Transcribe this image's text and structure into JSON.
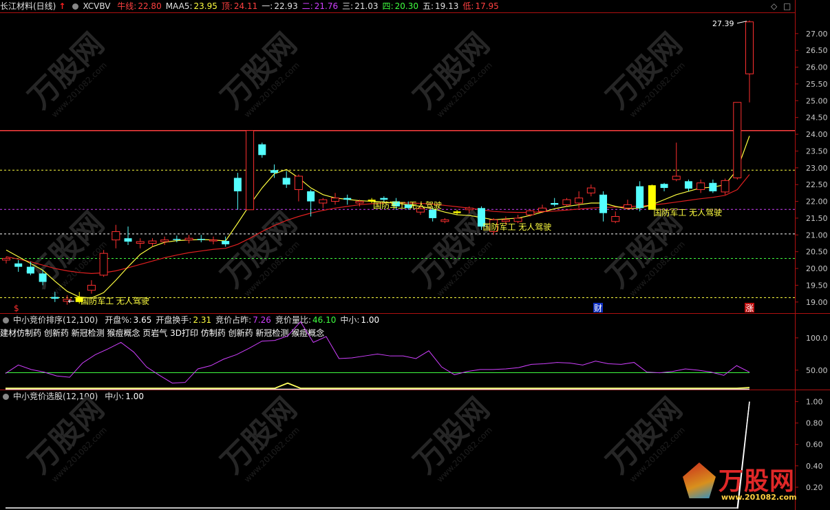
{
  "header": {
    "stock": "长江材料(日线)",
    "indicator": "XCVBV",
    "items": [
      {
        "label": "牛线",
        "value": "22.80",
        "label_color": "#ff4040",
        "value_color": "#ff4040"
      },
      {
        "label": "MAA5",
        "value": "23.95",
        "label_color": "#e0e0e0",
        "value_color": "#ffff40"
      },
      {
        "label": "顶",
        "value": "24.11",
        "label_color": "#ff4040",
        "value_color": "#ff4040"
      },
      {
        "label": "一",
        "value": "22.93",
        "label_color": "#e0e0e0",
        "value_color": "#e0e0e0"
      },
      {
        "label": "二",
        "value": "21.76",
        "label_color": "#d040ff",
        "value_color": "#d040ff"
      },
      {
        "label": "三",
        "value": "21.03",
        "label_color": "#e0e0e0",
        "value_color": "#e0e0e0"
      },
      {
        "label": "四",
        "value": "20.30",
        "label_color": "#40ff40",
        "value_color": "#40ff40"
      },
      {
        "label": "五",
        "value": "19.13",
        "label_color": "#e0e0e0",
        "value_color": "#e0e0e0"
      },
      {
        "label": "低",
        "value": "17.95",
        "label_color": "#ff4040",
        "value_color": "#ff4040"
      }
    ]
  },
  "panel2": {
    "title": "中小竞价排序",
    "params": "(12,100)",
    "items": [
      {
        "label": "开盘%",
        "value": "3.65",
        "color": "#ffffff"
      },
      {
        "label": "开盘换手",
        "value": "2.31",
        "color": "#ffff40"
      },
      {
        "label": "竞价占昨",
        "value": "7.26",
        "color": "#d040ff"
      },
      {
        "label": "竞价量比",
        "value": "46.10",
        "color": "#40ff40"
      },
      {
        "label": "中小",
        "value": "1.00",
        "color": "#ffffff"
      }
    ],
    "concepts": "建材仿制药 创新药 新冠检测 猴痘概念 页岩气 3D打印 仿制药 创新药 新冠检测 猴痘概念"
  },
  "panel3": {
    "title": "中小竞价选股",
    "params": "(12,100)",
    "items": [
      {
        "label": "中小",
        "value": "1.00",
        "color": "#ffffff"
      }
    ]
  },
  "annotations": {
    "tag": "国防军工 无人驾驶",
    "peak_label": "27.39",
    "marker_s": "$",
    "marker_cai": "财",
    "marker_zhang": "涨"
  },
  "watermark": {
    "text": "万股网",
    "url": "www.201082.com"
  },
  "colors": {
    "up": "#ff3030",
    "down": "#54ffff",
    "ma_fast": "#ffff40",
    "ma_slow": "#e02020",
    "purple": "#d040ff",
    "green": "#40ff40",
    "yellow": "#ffff00"
  },
  "chart_data": [
    {
      "type": "candlestick",
      "ylim": [
        18.75,
        27.55
      ],
      "yticks": [
        "19.00",
        "19.50",
        "20.00",
        "20.50",
        "21.00",
        "21.50",
        "22.00",
        "22.50",
        "23.00",
        "23.50",
        "24.00",
        "24.50",
        "25.00",
        "25.50",
        "26.00",
        "26.50",
        "27.00"
      ],
      "hlines": [
        {
          "value": 24.11,
          "color": "#ff4040",
          "style": "solid"
        },
        {
          "value": 22.93,
          "color": "#ffff40",
          "style": "dash"
        },
        {
          "value": 21.76,
          "color": "#d040ff",
          "style": "dash"
        },
        {
          "value": 21.03,
          "color": "#ffffff",
          "style": "dash"
        },
        {
          "value": 20.3,
          "color": "#40ff40",
          "style": "dash"
        },
        {
          "value": 19.13,
          "color": "#ffff40",
          "style": "dash"
        }
      ],
      "candles": [
        {
          "o": 20.25,
          "h": 20.35,
          "l": 20.15,
          "c": 20.3,
          "dir": "up"
        },
        {
          "o": 20.15,
          "h": 20.25,
          "l": 19.9,
          "c": 20.05,
          "dir": "down"
        },
        {
          "o": 20.05,
          "h": 20.2,
          "l": 19.8,
          "c": 19.85,
          "dir": "down"
        },
        {
          "o": 19.85,
          "h": 19.95,
          "l": 19.5,
          "c": 19.6,
          "dir": "down"
        },
        {
          "o": 19.15,
          "h": 19.3,
          "l": 19.0,
          "c": 19.1,
          "dir": "down"
        },
        {
          "o": 19.02,
          "h": 19.2,
          "l": 18.92,
          "c": 19.08,
          "dir": "up"
        },
        {
          "o": 19.0,
          "h": 19.3,
          "l": 18.95,
          "c": 19.15,
          "dir": "yellow"
        },
        {
          "o": 19.35,
          "h": 19.65,
          "l": 19.25,
          "c": 19.5,
          "dir": "up"
        },
        {
          "o": 19.8,
          "h": 20.55,
          "l": 19.75,
          "c": 20.45,
          "dir": "up"
        },
        {
          "o": 20.85,
          "h": 21.3,
          "l": 20.6,
          "c": 21.1,
          "dir": "up"
        },
        {
          "o": 20.9,
          "h": 21.25,
          "l": 20.7,
          "c": 20.8,
          "dir": "down"
        },
        {
          "o": 20.75,
          "h": 20.9,
          "l": 20.6,
          "c": 20.8,
          "dir": "up"
        },
        {
          "o": 20.75,
          "h": 20.9,
          "l": 20.65,
          "c": 20.82,
          "dir": "up"
        },
        {
          "o": 20.8,
          "h": 20.95,
          "l": 20.7,
          "c": 20.85,
          "dir": "up"
        },
        {
          "o": 20.88,
          "h": 20.98,
          "l": 20.78,
          "c": 20.85,
          "dir": "down"
        },
        {
          "o": 20.85,
          "h": 21.0,
          "l": 20.75,
          "c": 20.9,
          "dir": "up"
        },
        {
          "o": 20.88,
          "h": 21.0,
          "l": 20.78,
          "c": 20.86,
          "dir": "down"
        },
        {
          "o": 20.82,
          "h": 20.95,
          "l": 20.72,
          "c": 20.85,
          "dir": "up"
        },
        {
          "o": 20.82,
          "h": 20.95,
          "l": 20.65,
          "c": 20.72,
          "dir": "down"
        },
        {
          "o": 22.7,
          "h": 22.85,
          "l": 21.75,
          "c": 22.3,
          "dir": "down"
        },
        {
          "o": 21.75,
          "h": 24.11,
          "l": 21.75,
          "c": 24.11,
          "dir": "up"
        },
        {
          "o": 23.7,
          "h": 23.75,
          "l": 23.3,
          "c": 23.38,
          "dir": "down"
        },
        {
          "o": 22.93,
          "h": 23.1,
          "l": 22.7,
          "c": 22.85,
          "dir": "down"
        },
        {
          "o": 22.7,
          "h": 22.9,
          "l": 22.4,
          "c": 22.5,
          "dir": "down"
        },
        {
          "o": 22.35,
          "h": 22.8,
          "l": 22.0,
          "c": 22.75,
          "dir": "up"
        },
        {
          "o": 22.3,
          "h": 22.35,
          "l": 21.55,
          "c": 22.0,
          "dir": "down"
        },
        {
          "o": 21.95,
          "h": 22.1,
          "l": 21.8,
          "c": 22.05,
          "dir": "up"
        },
        {
          "o": 22.0,
          "h": 22.25,
          "l": 21.9,
          "c": 22.1,
          "dir": "up"
        },
        {
          "o": 22.1,
          "h": 22.2,
          "l": 21.9,
          "c": 22.05,
          "dir": "down"
        },
        {
          "o": 21.95,
          "h": 22.05,
          "l": 21.85,
          "c": 22.0,
          "dir": "up"
        },
        {
          "o": 22.05,
          "h": 22.1,
          "l": 21.95,
          "c": 22.0,
          "dir": "yellow"
        },
        {
          "o": 22.1,
          "h": 22.15,
          "l": 21.95,
          "c": 22.05,
          "dir": "down"
        },
        {
          "o": 22.0,
          "h": 22.1,
          "l": 21.75,
          "c": 21.85,
          "dir": "down"
        },
        {
          "o": 21.9,
          "h": 22.0,
          "l": 21.75,
          "c": 21.8,
          "dir": "down"
        },
        {
          "o": 21.78,
          "h": 21.9,
          "l": 21.6,
          "c": 21.68,
          "dir": "up"
        },
        {
          "o": 21.75,
          "h": 21.8,
          "l": 21.4,
          "c": 21.5,
          "dir": "down"
        },
        {
          "o": 21.4,
          "h": 21.5,
          "l": 21.35,
          "c": 21.45,
          "dir": "up"
        },
        {
          "o": 21.7,
          "h": 21.75,
          "l": 21.6,
          "c": 21.65,
          "dir": "yellow"
        },
        {
          "o": 21.75,
          "h": 21.85,
          "l": 21.65,
          "c": 21.8,
          "dir": "up"
        },
        {
          "o": 21.8,
          "h": 21.85,
          "l": 21.15,
          "c": 21.25,
          "dir": "down"
        },
        {
          "o": 21.1,
          "h": 21.5,
          "l": 21.0,
          "c": 21.45,
          "dir": "up"
        },
        {
          "o": 21.45,
          "h": 21.55,
          "l": 21.3,
          "c": 21.4,
          "dir": "up"
        },
        {
          "o": 21.4,
          "h": 21.6,
          "l": 21.35,
          "c": 21.5,
          "dir": "up"
        },
        {
          "o": 21.6,
          "h": 21.75,
          "l": 21.55,
          "c": 21.72,
          "dir": "up"
        },
        {
          "o": 21.7,
          "h": 21.9,
          "l": 21.65,
          "c": 21.8,
          "dir": "up"
        },
        {
          "o": 21.9,
          "h": 22.1,
          "l": 21.85,
          "c": 21.95,
          "dir": "down"
        },
        {
          "o": 21.9,
          "h": 22.1,
          "l": 21.85,
          "c": 22.05,
          "dir": "up"
        },
        {
          "o": 21.95,
          "h": 22.3,
          "l": 21.8,
          "c": 22.1,
          "dir": "up"
        },
        {
          "o": 22.25,
          "h": 22.5,
          "l": 22.15,
          "c": 22.4,
          "dir": "up"
        },
        {
          "o": 22.2,
          "h": 22.3,
          "l": 21.4,
          "c": 21.65,
          "dir": "down"
        },
        {
          "o": 21.4,
          "h": 21.7,
          "l": 21.35,
          "c": 21.55,
          "dir": "up"
        },
        {
          "o": 21.8,
          "h": 22.05,
          "l": 21.75,
          "c": 21.9,
          "dir": "up"
        },
        {
          "o": 22.45,
          "h": 22.6,
          "l": 21.7,
          "c": 21.8,
          "dir": "down"
        },
        {
          "o": 21.75,
          "h": 22.5,
          "l": 21.75,
          "c": 22.48,
          "dir": "yellow"
        },
        {
          "o": 22.4,
          "h": 22.55,
          "l": 22.3,
          "c": 22.52,
          "dir": "down"
        },
        {
          "o": 22.65,
          "h": 23.75,
          "l": 22.6,
          "c": 22.75,
          "dir": "up"
        },
        {
          "o": 22.6,
          "h": 22.65,
          "l": 22.3,
          "c": 22.38,
          "dir": "down"
        },
        {
          "o": 22.35,
          "h": 22.65,
          "l": 22.25,
          "c": 22.55,
          "dir": "up"
        },
        {
          "o": 22.55,
          "h": 22.65,
          "l": 22.25,
          "c": 22.3,
          "dir": "down"
        },
        {
          "o": 22.28,
          "h": 22.68,
          "l": 22.2,
          "c": 22.62,
          "dir": "up"
        },
        {
          "o": 22.7,
          "h": 24.95,
          "l": 22.65,
          "c": 24.95,
          "dir": "up"
        },
        {
          "o": 25.8,
          "h": 27.39,
          "l": 24.95,
          "c": 27.35,
          "dir": "up"
        }
      ],
      "ma_fast": [
        20.55,
        20.35,
        20.15,
        19.95,
        19.62,
        19.32,
        19.15,
        19.12,
        19.28,
        19.65,
        20.05,
        20.42,
        20.65,
        20.78,
        20.83,
        20.85,
        20.86,
        20.85,
        20.82,
        21.35,
        21.9,
        22.4,
        22.82,
        22.95,
        22.7,
        22.4,
        22.2,
        22.1,
        22.06,
        22.02,
        22.0,
        21.98,
        21.95,
        21.9,
        21.85,
        21.78,
        21.68,
        21.6,
        21.58,
        21.52,
        21.45,
        21.48,
        21.5,
        21.58,
        21.68,
        21.78,
        21.85,
        21.9,
        21.95,
        21.95,
        21.85,
        21.78,
        21.8,
        21.9,
        22.05,
        22.2,
        22.3,
        22.4,
        22.42,
        22.5,
        22.95,
        23.95
      ],
      "ma_slow": [
        20.35,
        20.28,
        20.2,
        20.1,
        20.0,
        19.93,
        19.88,
        19.85,
        19.87,
        19.93,
        20.02,
        20.12,
        20.22,
        20.32,
        20.4,
        20.47,
        20.52,
        20.57,
        20.6,
        20.72,
        20.9,
        21.1,
        21.28,
        21.43,
        21.55,
        21.65,
        21.73,
        21.8,
        21.85,
        21.9,
        21.93,
        21.95,
        21.96,
        21.95,
        21.94,
        21.92,
        21.88,
        21.84,
        21.8,
        21.75,
        21.7,
        21.68,
        21.67,
        21.67,
        21.69,
        21.71,
        21.74,
        21.77,
        21.8,
        21.82,
        21.83,
        21.84,
        21.86,
        21.89,
        21.93,
        21.98,
        22.03,
        22.08,
        22.12,
        22.18,
        22.35,
        22.8
      ]
    },
    {
      "type": "line",
      "ylim": [
        20,
        118
      ],
      "yticks": [
        "50.00",
        "100.0"
      ],
      "hline": 46.1,
      "series": [
        {
          "name": "竞价占昨",
          "color": "#d040ff",
          "values": [
            45,
            58,
            51,
            47,
            41,
            39,
            61,
            74,
            83,
            93,
            78,
            55,
            42,
            30,
            31,
            52,
            57,
            67,
            74,
            84,
            95,
            96,
            103,
            125,
            93,
            102,
            68,
            69,
            72,
            75,
            72,
            72,
            68,
            80,
            55,
            43,
            48,
            51,
            51,
            52,
            54,
            59,
            60,
            62,
            61,
            58,
            64,
            60,
            59,
            62,
            47,
            46,
            48,
            52,
            50,
            47,
            42,
            57,
            47
          ]
        },
        {
          "name": "开盘换手",
          "color": "#ffff60",
          "values": [
            22,
            22,
            22,
            22,
            22,
            22,
            22,
            22,
            22,
            22,
            22,
            22,
            22,
            22,
            22,
            22,
            22,
            22,
            22,
            22,
            22,
            22,
            30,
            22,
            22,
            22,
            22,
            22,
            22,
            22,
            22,
            22,
            22,
            22,
            22,
            22,
            22,
            22,
            22,
            22,
            22,
            22,
            22,
            22,
            22,
            22,
            22,
            22,
            22,
            22,
            22,
            22,
            22,
            22,
            22,
            22,
            22,
            22,
            23
          ]
        }
      ]
    },
    {
      "type": "line",
      "ylim": [
        0,
        1.1
      ],
      "yticks": [
        "0.20",
        "0.40",
        "0.60",
        "0.80",
        "1.00"
      ],
      "series": [
        {
          "name": "中小",
          "color": "#ffffff",
          "values": [
            0,
            0,
            0,
            0,
            0,
            0,
            0,
            0,
            0,
            0,
            0,
            0,
            0,
            0,
            0,
            0,
            0,
            0,
            0,
            0,
            0,
            0,
            0,
            0,
            0,
            0,
            0,
            0,
            0,
            0,
            0,
            0,
            0,
            0,
            0,
            0,
            0,
            0,
            0,
            0,
            0,
            0,
            0,
            0,
            0,
            0,
            0,
            0,
            0,
            0,
            0,
            0,
            0,
            0,
            0,
            0,
            0,
            0,
            0,
            0,
            0,
            1.0
          ]
        }
      ]
    }
  ]
}
